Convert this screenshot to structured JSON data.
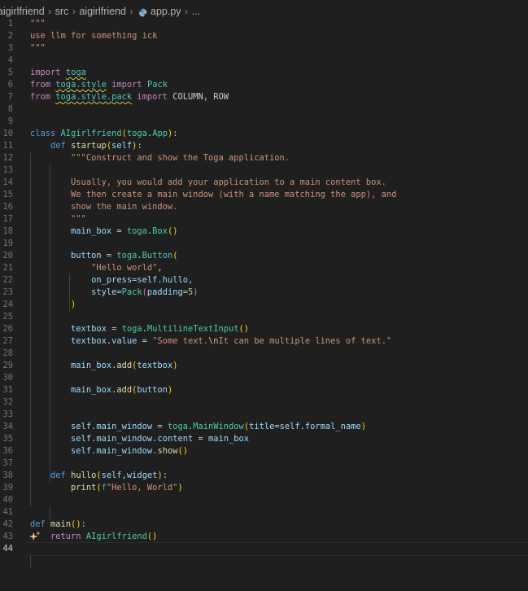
{
  "breadcrumb": {
    "items": [
      "aigirlfriend",
      "src",
      "aigirlfriend",
      "app.py",
      "..."
    ]
  },
  "editor": {
    "current_line": 44,
    "lines": [
      [
        [
          "\"\"\"",
          "str"
        ]
      ],
      [
        [
          "use llm for something ick",
          "str"
        ]
      ],
      [
        [
          "\"\"\"",
          "str"
        ]
      ],
      [],
      [
        [
          "import",
          "kw"
        ],
        [
          " ",
          "pl"
        ],
        [
          "toga",
          "cls squig"
        ]
      ],
      [
        [
          "from",
          "kw"
        ],
        [
          " ",
          "pl"
        ],
        [
          "toga.style",
          "cls squig"
        ],
        [
          " ",
          "pl"
        ],
        [
          "import",
          "kw"
        ],
        [
          " ",
          "pl"
        ],
        [
          "Pack",
          "cls"
        ]
      ],
      [
        [
          "from",
          "kw"
        ],
        [
          " ",
          "pl"
        ],
        [
          "toga.style.pack",
          "cls squig"
        ],
        [
          " ",
          "pl"
        ],
        [
          "import",
          "kw"
        ],
        [
          " ",
          "pl"
        ],
        [
          "COLUMN, ROW",
          "pl"
        ]
      ],
      [],
      [],
      [
        [
          "class",
          "kwb"
        ],
        [
          " ",
          "pl"
        ],
        [
          "AIgirlfriend",
          "cls"
        ],
        [
          "(",
          "br1"
        ],
        [
          "toga",
          "cls"
        ],
        [
          ".",
          "pl"
        ],
        [
          "App",
          "cls"
        ],
        [
          ")",
          "br1"
        ],
        [
          ":",
          "pl"
        ]
      ],
      [
        [
          "    ",
          "pl"
        ],
        [
          "def",
          "kwb"
        ],
        [
          " ",
          "pl"
        ],
        [
          "startup",
          "fn"
        ],
        [
          "(",
          "br1"
        ],
        [
          "self",
          "var"
        ],
        [
          ")",
          "br1"
        ],
        [
          ":",
          "pl"
        ]
      ],
      [
        [
          "        ",
          "pl"
        ],
        [
          "\"\"\"Construct and show the Toga application.",
          "str"
        ]
      ],
      [],
      [
        [
          "        ",
          "pl"
        ],
        [
          "Usually, you would add your application to a main content box.",
          "str"
        ]
      ],
      [
        [
          "        ",
          "pl"
        ],
        [
          "We then create a main window (with a name matching the app), and",
          "str"
        ]
      ],
      [
        [
          "        ",
          "pl"
        ],
        [
          "show the main window.",
          "str"
        ]
      ],
      [
        [
          "        ",
          "pl"
        ],
        [
          "\"\"\"",
          "str"
        ]
      ],
      [
        [
          "        ",
          "pl"
        ],
        [
          "main_box",
          "var"
        ],
        [
          " = ",
          "pl"
        ],
        [
          "toga",
          "cls"
        ],
        [
          ".",
          "pl"
        ],
        [
          "Box",
          "cls"
        ],
        [
          "()",
          "br1"
        ]
      ],
      [],
      [
        [
          "        ",
          "pl"
        ],
        [
          "button",
          "var"
        ],
        [
          " = ",
          "pl"
        ],
        [
          "toga",
          "cls"
        ],
        [
          ".",
          "pl"
        ],
        [
          "Button",
          "cls"
        ],
        [
          "(",
          "br1"
        ]
      ],
      [
        [
          "            ",
          "pl"
        ],
        [
          "\"Hello world\"",
          "str"
        ],
        [
          ",",
          "pl"
        ]
      ],
      [
        [
          "            ",
          "pl"
        ],
        [
          "on_press",
          "var"
        ],
        [
          "=",
          "pl"
        ],
        [
          "self",
          "var"
        ],
        [
          ".",
          "pl"
        ],
        [
          "hullo",
          "var"
        ],
        [
          ",",
          "pl"
        ]
      ],
      [
        [
          "            ",
          "pl"
        ],
        [
          "style",
          "var"
        ],
        [
          "=",
          "pl"
        ],
        [
          "Pack",
          "cls"
        ],
        [
          "(",
          "br2"
        ],
        [
          "padding",
          "var"
        ],
        [
          "=",
          "pl"
        ],
        [
          "5",
          "num"
        ],
        [
          ")",
          "br2"
        ]
      ],
      [
        [
          "        ",
          "pl"
        ],
        [
          ")",
          "br1"
        ]
      ],
      [],
      [
        [
          "        ",
          "pl"
        ],
        [
          "textbox",
          "var"
        ],
        [
          " = ",
          "pl"
        ],
        [
          "toga",
          "cls"
        ],
        [
          ".",
          "pl"
        ],
        [
          "MultilineTextInput",
          "cls"
        ],
        [
          "()",
          "br1"
        ]
      ],
      [
        [
          "        ",
          "pl"
        ],
        [
          "textbox",
          "var"
        ],
        [
          ".",
          "pl"
        ],
        [
          "value",
          "var"
        ],
        [
          " = ",
          "pl"
        ],
        [
          "\"Some text.",
          "str"
        ],
        [
          "\\n",
          "esc"
        ],
        [
          "It can be multiple lines of text.\"",
          "str"
        ]
      ],
      [],
      [
        [
          "        ",
          "pl"
        ],
        [
          "main_box",
          "var"
        ],
        [
          ".",
          "pl"
        ],
        [
          "add",
          "fn"
        ],
        [
          "(",
          "br1"
        ],
        [
          "textbox",
          "var"
        ],
        [
          ")",
          "br1"
        ]
      ],
      [],
      [
        [
          "        ",
          "pl"
        ],
        [
          "main_box",
          "var"
        ],
        [
          ".",
          "pl"
        ],
        [
          "add",
          "fn"
        ],
        [
          "(",
          "br1"
        ],
        [
          "button",
          "var"
        ],
        [
          ")",
          "br1"
        ]
      ],
      [],
      [],
      [
        [
          "        ",
          "pl"
        ],
        [
          "self",
          "var"
        ],
        [
          ".",
          "pl"
        ],
        [
          "main_window",
          "var"
        ],
        [
          " = ",
          "pl"
        ],
        [
          "toga",
          "cls"
        ],
        [
          ".",
          "pl"
        ],
        [
          "MainWindow",
          "cls"
        ],
        [
          "(",
          "br1"
        ],
        [
          "title",
          "var"
        ],
        [
          "=",
          "pl"
        ],
        [
          "self",
          "var"
        ],
        [
          ".",
          "pl"
        ],
        [
          "formal_name",
          "var"
        ],
        [
          ")",
          "br1"
        ]
      ],
      [
        [
          "        ",
          "pl"
        ],
        [
          "self",
          "var"
        ],
        [
          ".",
          "pl"
        ],
        [
          "main_window",
          "var"
        ],
        [
          ".",
          "pl"
        ],
        [
          "content",
          "var"
        ],
        [
          " = ",
          "pl"
        ],
        [
          "main_box",
          "var"
        ]
      ],
      [
        [
          "        ",
          "pl"
        ],
        [
          "self",
          "var"
        ],
        [
          ".",
          "pl"
        ],
        [
          "main_window",
          "var"
        ],
        [
          ".",
          "pl"
        ],
        [
          "show",
          "fn"
        ],
        [
          "()",
          "br1"
        ]
      ],
      [],
      [
        [
          "    ",
          "pl"
        ],
        [
          "def",
          "kwb"
        ],
        [
          " ",
          "pl"
        ],
        [
          "hullo",
          "fn"
        ],
        [
          "(",
          "br1"
        ],
        [
          "self",
          "var"
        ],
        [
          ",",
          "pl"
        ],
        [
          "widget",
          "var"
        ],
        [
          ")",
          "br1"
        ],
        [
          ":",
          "pl"
        ]
      ],
      [
        [
          "        ",
          "pl"
        ],
        [
          "print",
          "fn"
        ],
        [
          "(",
          "br1"
        ],
        [
          "f",
          "kwb"
        ],
        [
          "\"Hello, World\"",
          "str"
        ],
        [
          ")",
          "br1"
        ]
      ],
      [],
      [],
      [
        [
          "def",
          "kwb"
        ],
        [
          " ",
          "pl"
        ],
        [
          "main",
          "fn"
        ],
        [
          "()",
          "br1"
        ],
        [
          ":",
          "pl"
        ]
      ],
      [
        [
          "    ",
          "pl"
        ],
        [
          "return",
          "kw"
        ],
        [
          " ",
          "pl"
        ],
        [
          "AIgirlfriend",
          "cls"
        ],
        [
          "()",
          "br1"
        ]
      ],
      []
    ]
  }
}
